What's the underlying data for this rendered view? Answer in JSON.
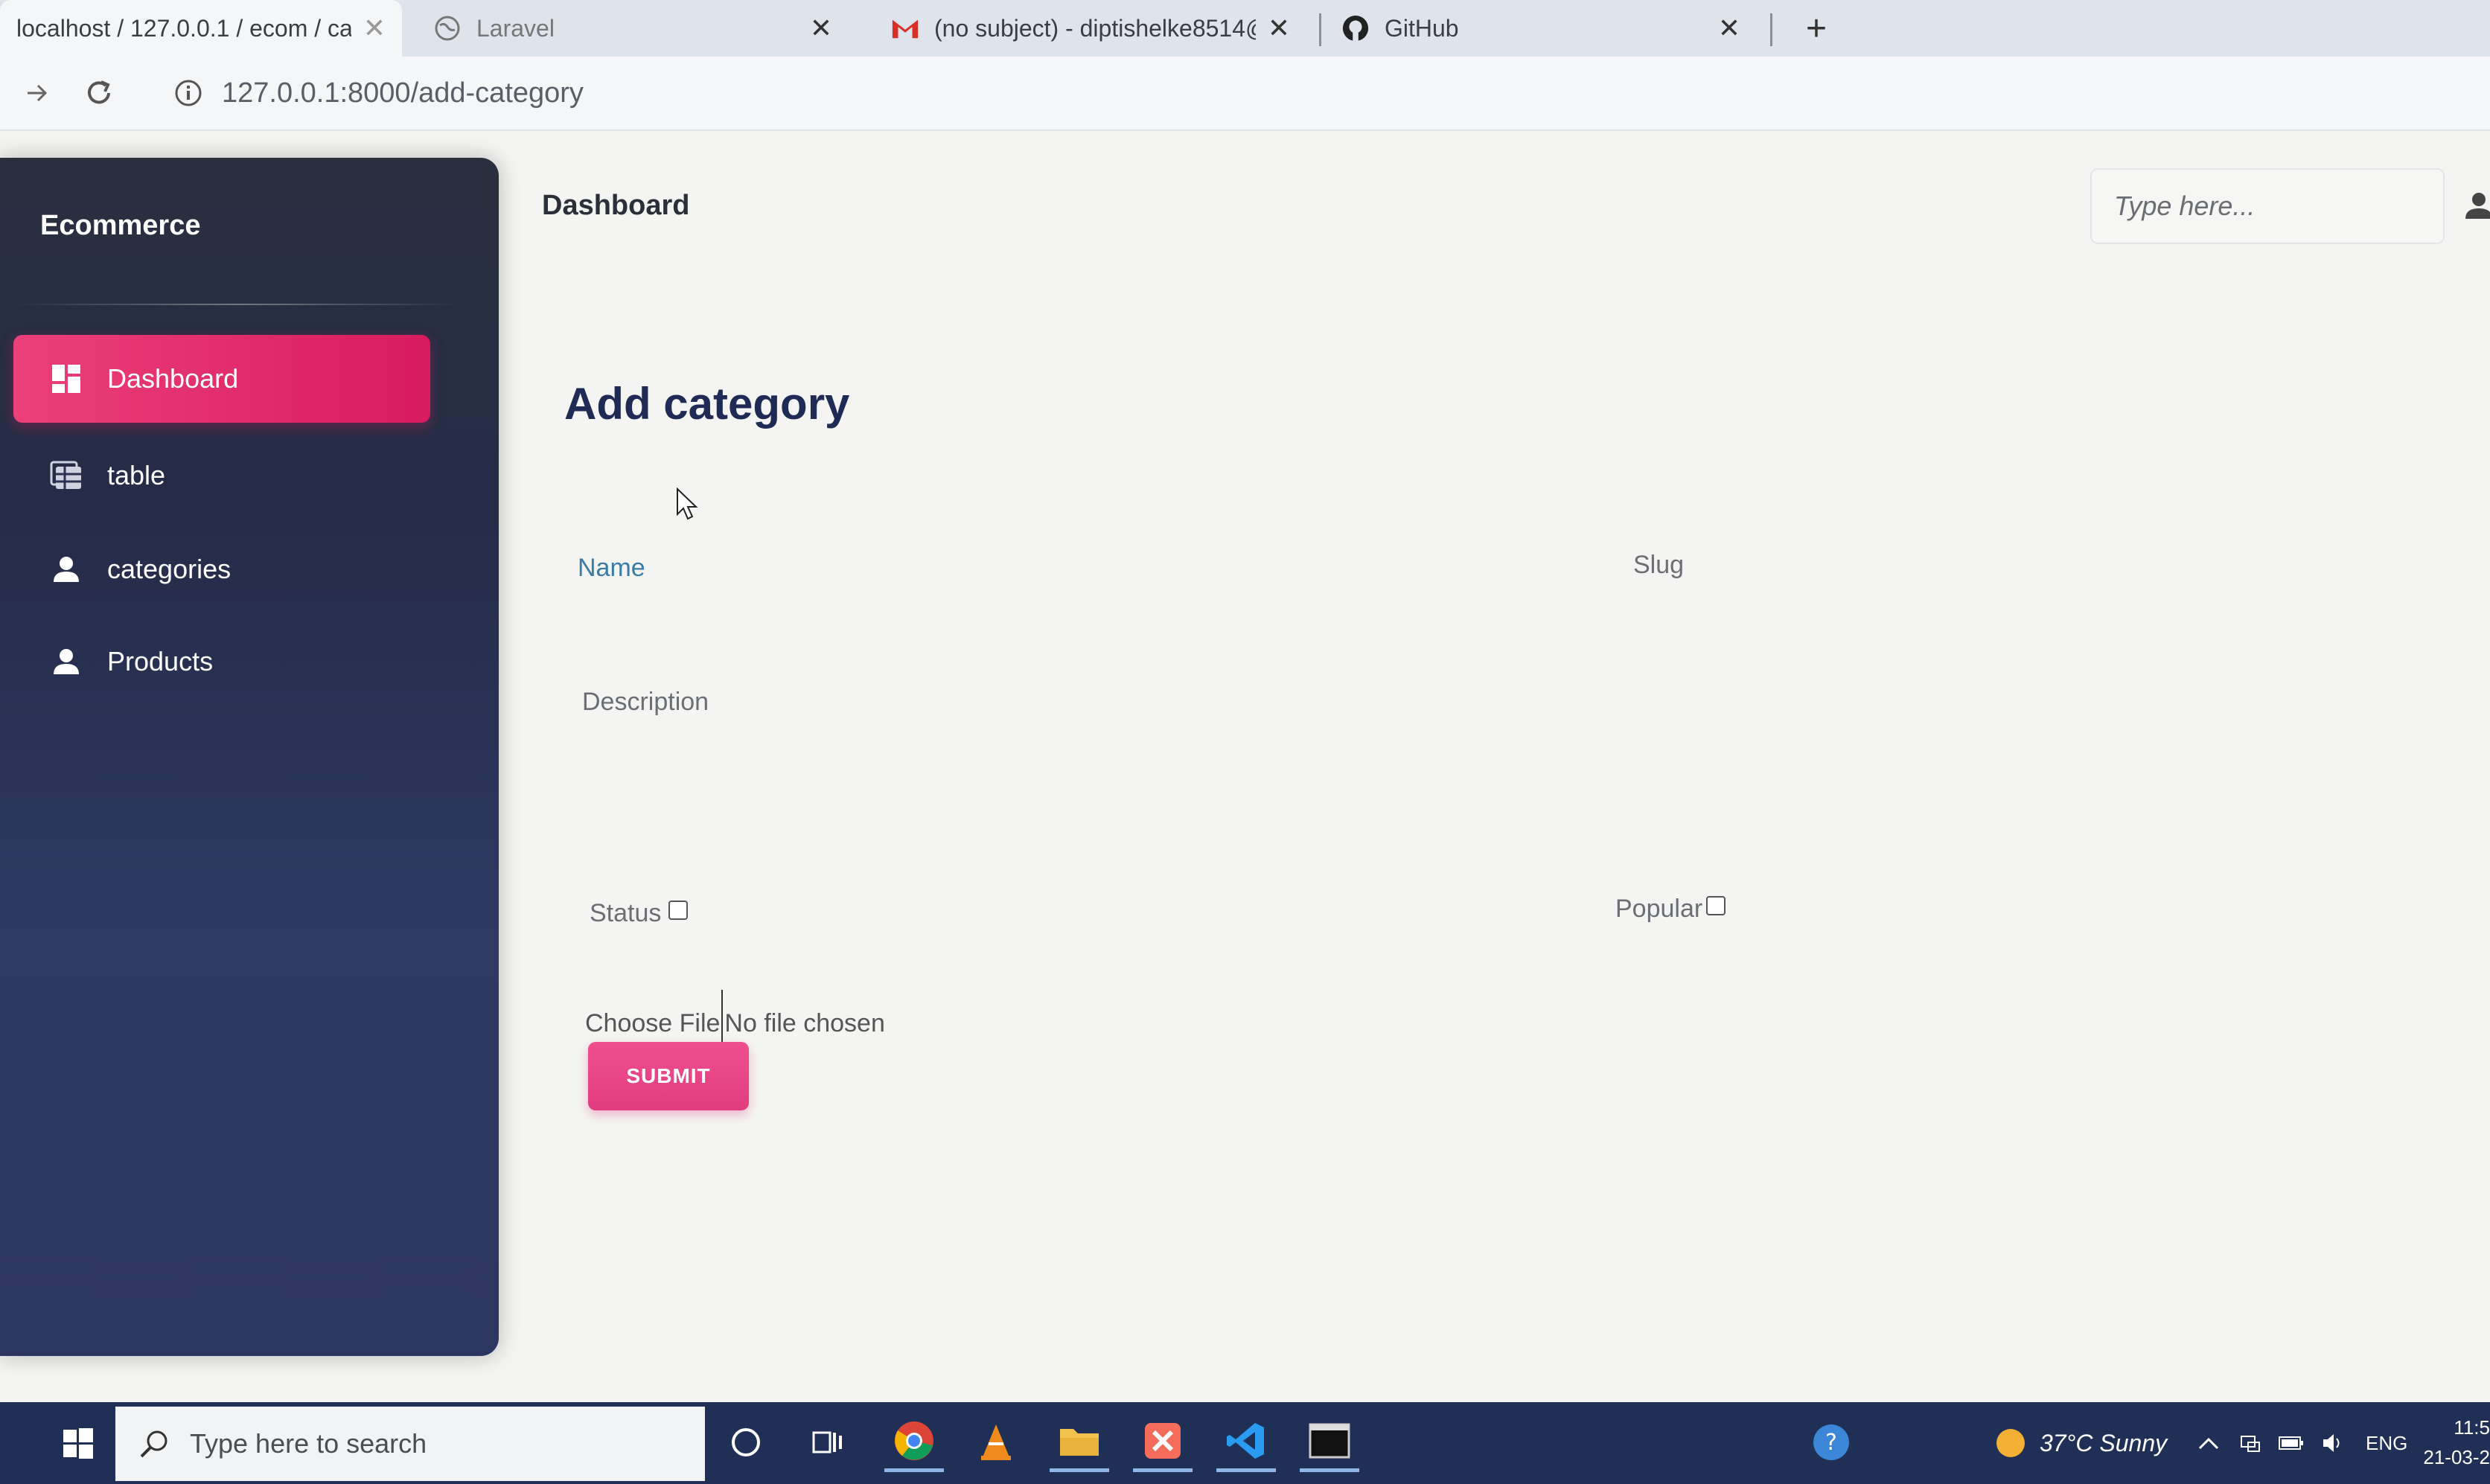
{
  "browser": {
    "tabs": [
      {
        "title": "localhost / 127.0.0.1 / ecom / ca",
        "icon": "page-icon",
        "active": true
      },
      {
        "title": "Laravel",
        "icon": "globe-icon",
        "active": false
      },
      {
        "title": "(no subject) - diptishelke8514@g",
        "icon": "gmail-icon",
        "active": false
      },
      {
        "title": "GitHub",
        "icon": "github-icon",
        "active": false
      }
    ],
    "new_tab_label": "+",
    "close_label": "✕",
    "url": "127.0.0.1:8000/add-category"
  },
  "sidebar": {
    "brand": "Ecommerce",
    "items": [
      {
        "label": "Dashboard",
        "icon": "dashboard-grid-icon",
        "active": true
      },
      {
        "label": "table",
        "icon": "table-icon",
        "active": false
      },
      {
        "label": "categories",
        "icon": "person-icon",
        "active": false
      },
      {
        "label": "Products",
        "icon": "person-icon",
        "active": false
      }
    ],
    "active_color": "#e91e63"
  },
  "header": {
    "title": "Dashboard",
    "search_placeholder": "Type here..."
  },
  "form": {
    "title": "Add category",
    "name_label": "Name",
    "slug_label": "Slug",
    "description_label": "Description",
    "status_label": "Status",
    "popular_label": "Popular",
    "file_button": "Choose File",
    "file_status": "No file chosen",
    "submit_label": "SUBMIT"
  },
  "taskbar": {
    "search_placeholder": "Type here to search",
    "weather": "37°C  Sunny",
    "language": "ENG",
    "time": "11:5",
    "date": "21-03-2"
  }
}
